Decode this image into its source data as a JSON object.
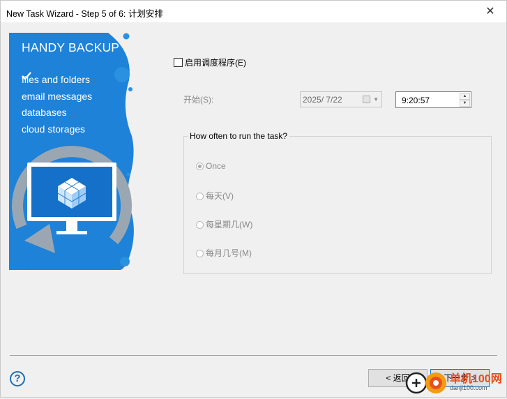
{
  "window": {
    "title": "New Task Wizard - Step 5 of 6: 计划安排"
  },
  "banner": {
    "brand": "HANDY BACKUP",
    "features": [
      "files and folders",
      "email messages",
      "databases",
      "cloud storages"
    ]
  },
  "schedule": {
    "enable_label": "启用调度程序(E)",
    "start_label": "开始(S):",
    "date_value": "2025/  7/22",
    "time_value": "9:20:57"
  },
  "frequency": {
    "group_label": "How often to run the task?",
    "options": [
      "Once",
      "每天(V)",
      "每星期几(W)",
      "每月几号(M)"
    ],
    "selected": "Once"
  },
  "footer": {
    "help_glyph": "?",
    "back_label": "< 返回",
    "next_label": "下一步 >"
  },
  "watermark": {
    "brand": "单机100网",
    "url": "danji100.com"
  },
  "colors": {
    "banner_blue": "#1e82d8",
    "accent": "#0078d7"
  }
}
